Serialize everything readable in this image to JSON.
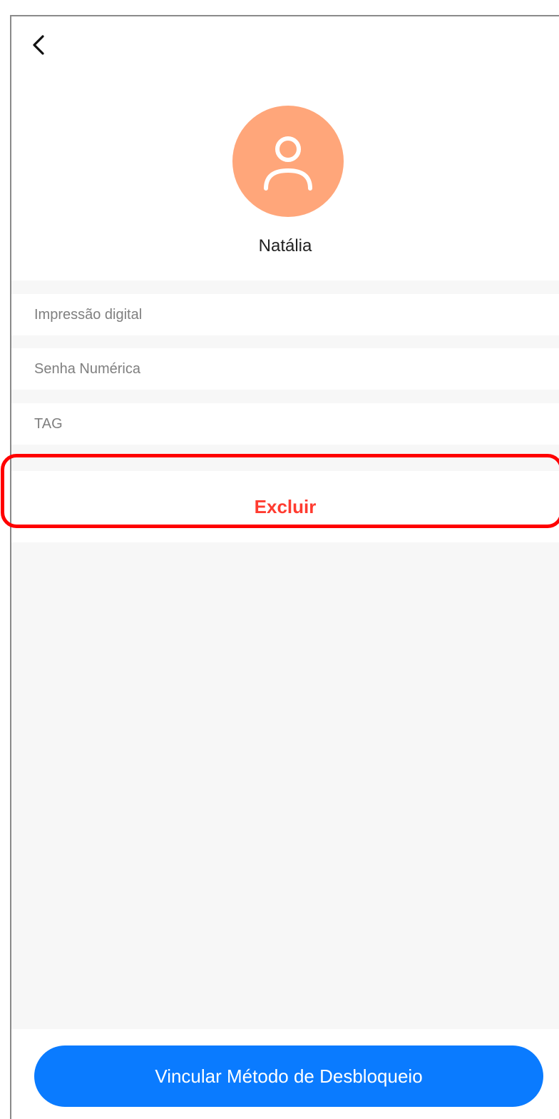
{
  "header": {
    "back_icon": "chevron-left-icon",
    "avatar_icon": "user-icon",
    "avatar_color": "#ffa67a",
    "name": "Natália"
  },
  "methods": [
    {
      "label": "Impressão digital"
    },
    {
      "label": "Senha Numérica"
    },
    {
      "label": "TAG"
    }
  ],
  "actions": {
    "delete_label": "Excluir",
    "delete_color": "#ff3b30",
    "bind_label": "Vincular Método de Desbloqueio",
    "bind_color": "#0a7bff"
  }
}
